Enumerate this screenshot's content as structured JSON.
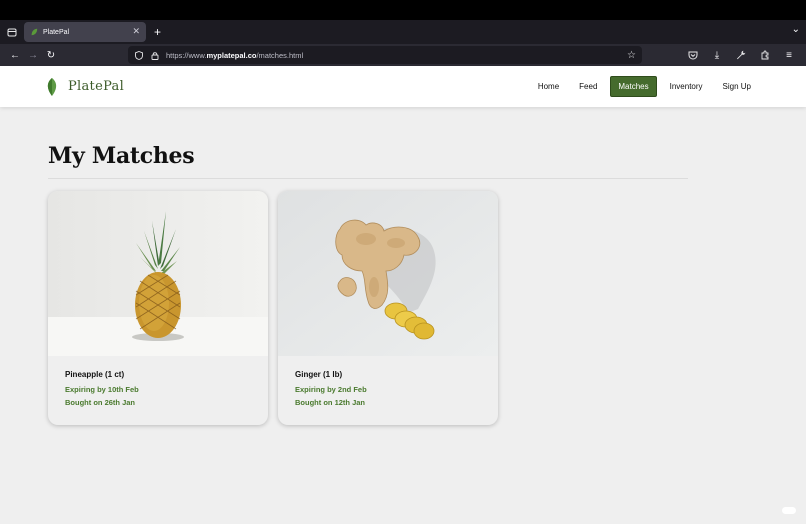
{
  "browser": {
    "tab_title": "PlatePal",
    "url_prefix": "https://www.",
    "url_domain": "myplatepal.co",
    "url_path": "/matches.html"
  },
  "site": {
    "brand": "PlatePal",
    "nav": [
      {
        "label": "Home",
        "active": false
      },
      {
        "label": "Feed",
        "active": false
      },
      {
        "label": "Matches",
        "active": true
      },
      {
        "label": "Inventory",
        "active": false
      },
      {
        "label": "Sign Up",
        "active": false
      }
    ],
    "accent_color": "#456b2d",
    "text_green": "#4a7a2e"
  },
  "main": {
    "title": "My Matches",
    "cards": [
      {
        "title": "Pineapple (1 ct)",
        "expiry": "Expiring by 10th Feb",
        "bought": "Bought on 26th Jan",
        "image": "pineapple-image"
      },
      {
        "title": "Ginger (1 lb)",
        "expiry": "Expiring by 2nd Feb",
        "bought": "Bought on 12th Jan",
        "image": "ginger-image"
      }
    ]
  }
}
